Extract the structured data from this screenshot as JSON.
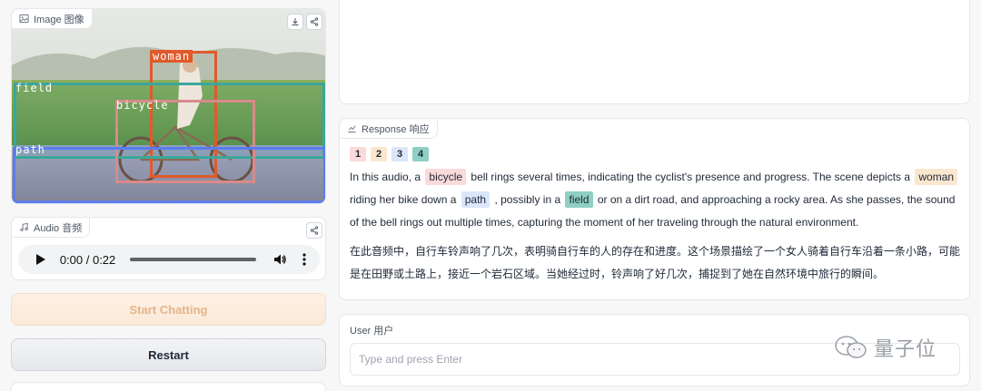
{
  "image_panel": {
    "label": "Image 图像",
    "icons": [
      "image-icon",
      "download-icon",
      "share-icon"
    ],
    "boxes": [
      {
        "label": "woman",
        "color": "#e05a2b"
      },
      {
        "label": "field",
        "color": "#3aa79b"
      },
      {
        "label": "bicycle",
        "color": "#d98a8a"
      },
      {
        "label": "path",
        "color": "#5b7cf0"
      }
    ]
  },
  "audio_panel": {
    "label": "Audio 音频",
    "time": "0:00 / 0:22"
  },
  "buttons": {
    "start": "Start Chatting",
    "restart": "Restart"
  },
  "response_panel": {
    "label": "Response 响应",
    "legend": [
      {
        "num": "1",
        "bg": "#fbdada"
      },
      {
        "num": "2",
        "bg": "#fbe7cf"
      },
      {
        "num": "3",
        "bg": "#dbe6fb"
      },
      {
        "num": "4",
        "bg": "#8fcfc4"
      }
    ],
    "en": {
      "p1": "In this audio, a",
      "h1": "bicycle",
      "p2": "bell rings several times, indicating the cyclist's presence and progress. The scene depicts a",
      "h2": "woman",
      "p3": "riding her bike down a",
      "h3": "path",
      "p4": ", possibly in a",
      "h4": "field",
      "p5": "or on a dirt road, and approaching a rocky area. As she passes, the sound of the bell rings out multiple times, capturing the moment of her traveling through the natural environment."
    },
    "zh": "在此音频中，自行车铃声响了几次，表明骑自行车的人的存在和进度。这个场景描绘了一个女人骑着自行车沿着一条小路，可能是在田野或土路上，接近一个岩石区域。当她经过时，铃声响了好几次，捕捉到了她在自然环境中旅行的瞬间。"
  },
  "user_panel": {
    "label": "User 用户",
    "placeholder": "Type and press Enter"
  },
  "watermark": "量子位"
}
